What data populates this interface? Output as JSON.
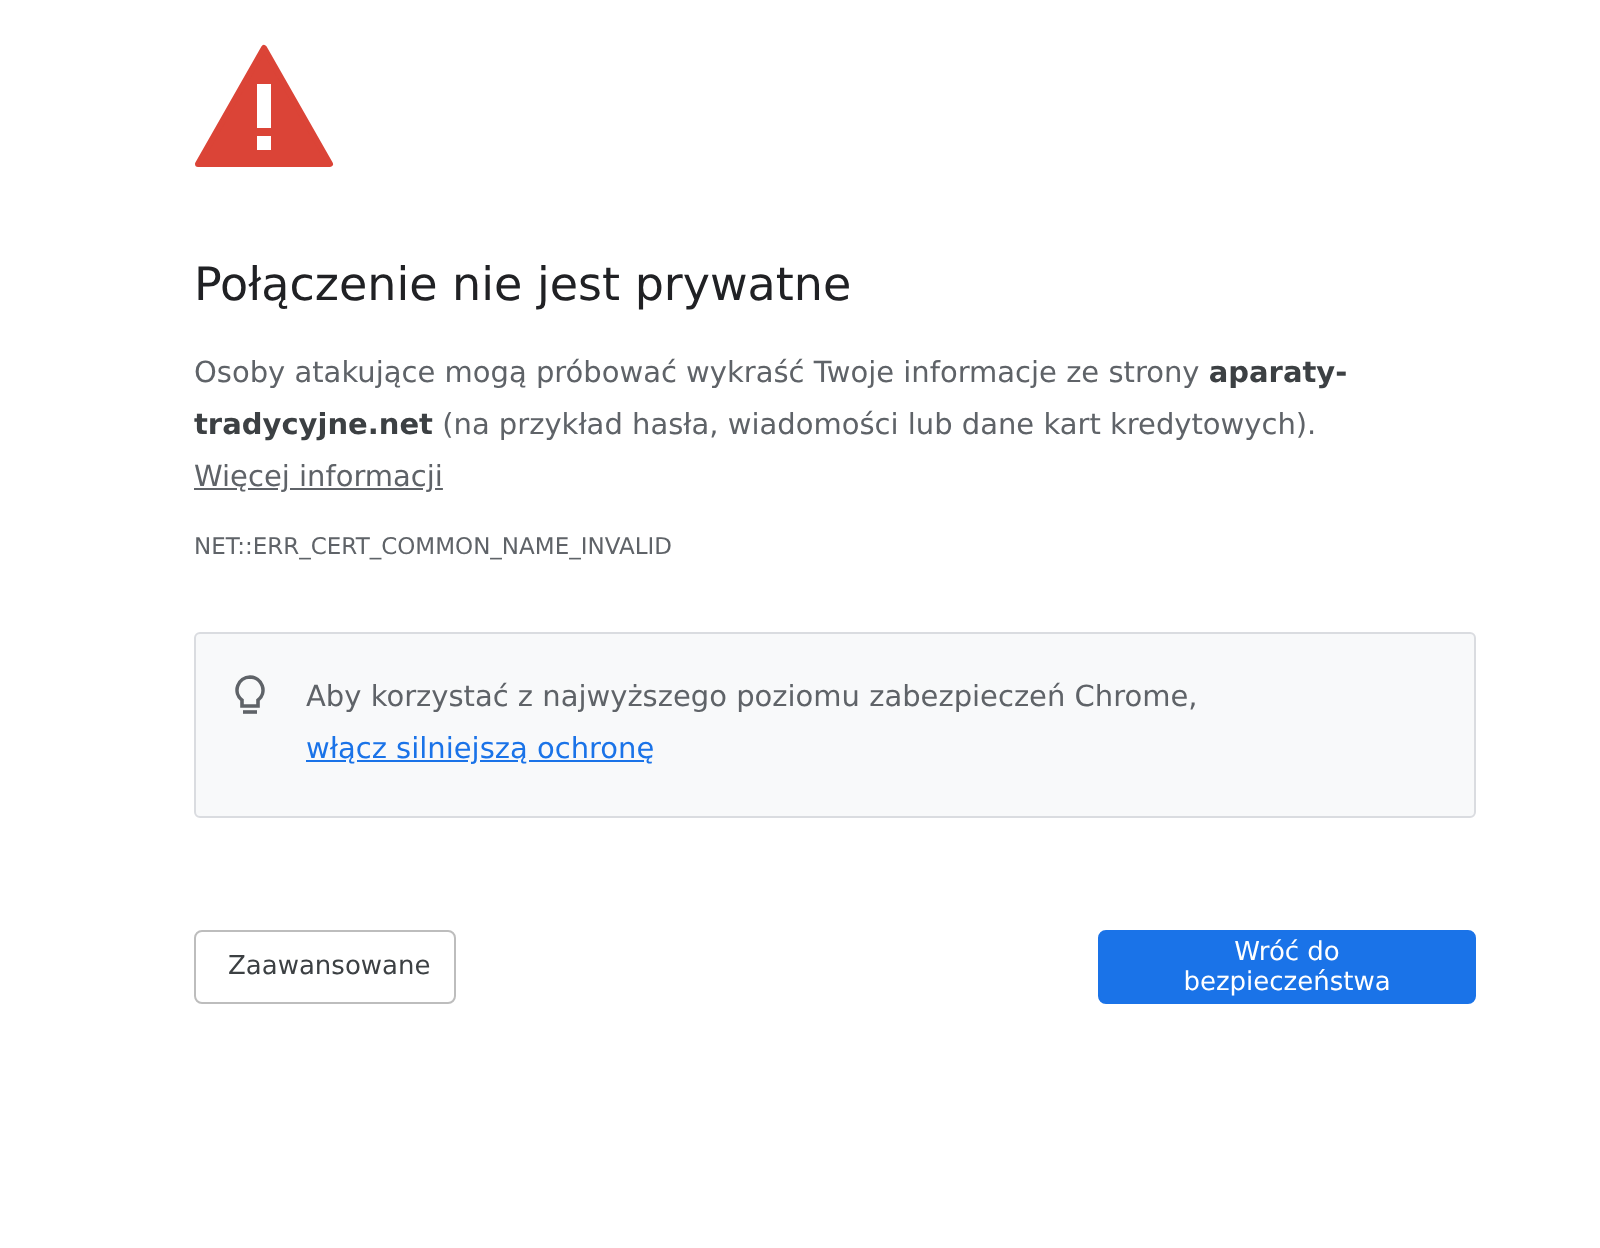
{
  "heading": "Połączenie nie jest prywatne",
  "description": {
    "text": "Osoby atakujące mogą próbować wykraść Twoje informacje ze strony **aparaty-tradycyjne.net** (na przykład hasła, wiadomości lub dane kart kredytowych).",
    "link": "Więcej informacji"
  },
  "error_code": "NET::ERR_CERT_COMMON_NAME_INVALID",
  "hint": {
    "text": "Aby korzystać z najwyższego poziomu zabezpieczeń Chrome,",
    "link": "włącz silniejszą ochronę"
  },
  "buttons": [
    {
      "label": "Zaawansowane",
      "kind": "secondary"
    },
    {
      "label": "Wróć do bezpieczeństwa",
      "kind": "primary"
    }
  ]
}
